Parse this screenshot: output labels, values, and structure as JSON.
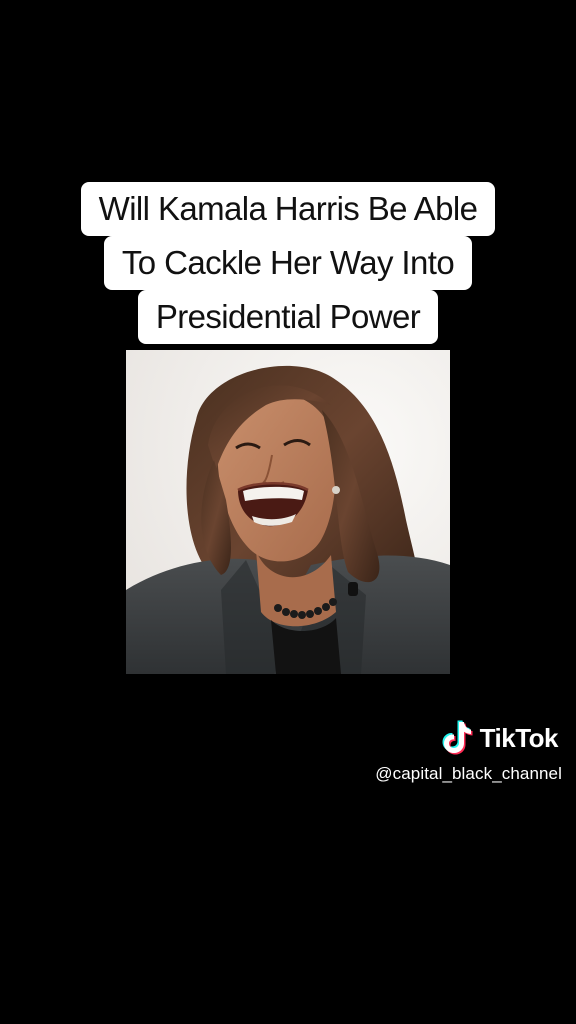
{
  "caption": {
    "lines": [
      "Will Kamala Harris Be Able",
      "To Cackle Her Way Into",
      "Presidential Power"
    ]
  },
  "watermark": {
    "brand": "TikTok",
    "handle": "@capital_black_channel",
    "icon": "tiktok-note-icon"
  },
  "colors": {
    "background": "#000000",
    "caption_bg": "#ffffff",
    "caption_text": "#111111",
    "watermark_text": "#ffffff",
    "tiktok_cyan": "#25f4ee",
    "tiktok_red": "#fe2c55"
  }
}
